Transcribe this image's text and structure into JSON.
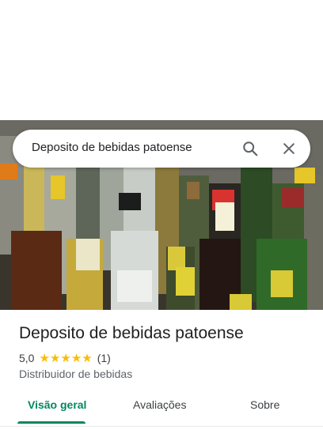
{
  "search": {
    "query": "Deposito de bebidas patoense",
    "search_icon": "search-icon",
    "close_icon": "close-icon"
  },
  "place": {
    "name": "Deposito de bebidas patoense",
    "rating": "5,0",
    "stars": 5,
    "review_count": "(1)",
    "category": "Distribuidor de bebidas"
  },
  "tabs": [
    {
      "label": "Visão geral",
      "active": true
    },
    {
      "label": "Avaliações",
      "active": false
    },
    {
      "label": "Sobre",
      "active": false
    }
  ],
  "colors": {
    "accent": "#01875f",
    "star": "#fbbc04"
  }
}
